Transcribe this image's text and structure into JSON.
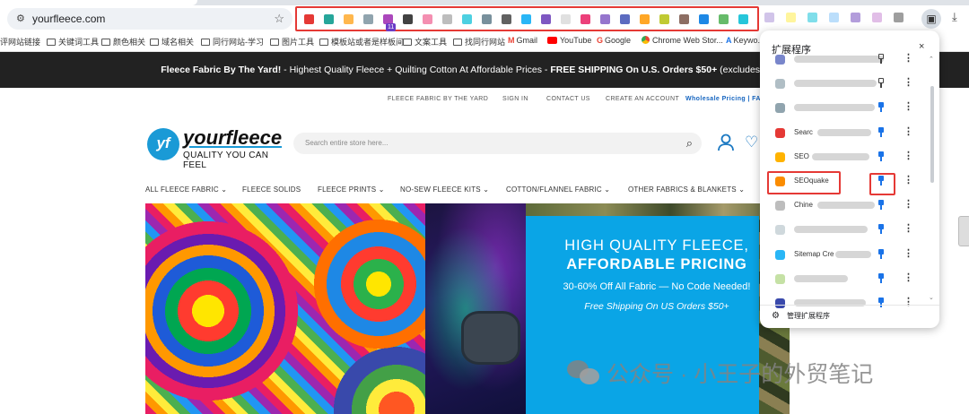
{
  "browser": {
    "url": "yourfleece.com",
    "bookmarks": [
      "评网站链接",
      "关键词工具",
      "颜色相关",
      "域名相关",
      "同行网站-学习",
      "图片工具",
      "模板站或者是样板间",
      "文案工具",
      "找同行网站",
      "Gmail",
      "YouTube",
      "Google",
      "Chrome Web Stor...",
      "Keywo..."
    ],
    "extension_badge": "11",
    "toolbar_extension_colors": [
      "#e53935",
      "#26a69a",
      "#ffb74d",
      "#90a4ae",
      "#ab47bc",
      "#424242",
      "#f48fb1",
      "#bdbdbd",
      "#4dd0e1",
      "#78909c",
      "#616161",
      "#29b6f6",
      "#7e57c2",
      "#e0e0e0",
      "#ec407a",
      "#9575cd",
      "#5c6bc0",
      "#ffa726",
      "#c0ca33",
      "#8d6e63",
      "#1e88e5",
      "#66bb6a",
      "#26c6da"
    ],
    "extra_extension_colors": [
      "#d1c4e9",
      "#fff59d",
      "#80deea",
      "#bbdefb",
      "#b39ddb",
      "#e1bee7",
      "#9e9e9e"
    ]
  },
  "promo": {
    "bold_a": "Fleece Fabric By The Yard!",
    "mid": " - Highest Quality Fleece + Quilting Cotton At Affordable Prices - ",
    "bold_b": "FREE SHIPPING On U.S. Orders $50+",
    "tail": " (excludes HI and AK)"
  },
  "util_links": {
    "fleece": "FLEECE FABRIC BY THE YARD",
    "signin": "SIGN IN",
    "contact": "CONTACT US",
    "create": "CREATE AN ACCOUNT",
    "wholesale": "Wholesale Pricing | FAQ"
  },
  "logo": {
    "mark": "yf",
    "word": "yourfleece",
    "tagline": "QUALITY YOU CAN FEEL"
  },
  "search": {
    "placeholder": "Search entire store here..."
  },
  "nav": [
    "ALL FLEECE FABRIC ⌄",
    "FLEECE SOLIDS",
    "FLEECE PRINTS ⌄",
    "NO-SEW FLEECE KITS ⌄",
    "COTTON/FLANNEL FABRIC ⌄",
    "OTHER FABRICS & BLANKETS ⌄"
  ],
  "hero": {
    "line1": "HIGH QUALITY FLEECE,",
    "line2": "AFFORDABLE PRICING",
    "line3": "30-60% Off All Fabric — No Code Needed!",
    "line4": "Free Shipping On US Orders $50+"
  },
  "popup": {
    "title": "扩展程序",
    "close": "×",
    "manage": "管理扩展程序",
    "items": [
      {
        "name": "",
        "color": "#7986cb",
        "pinned": false,
        "blur": [
          38,
          100
        ]
      },
      {
        "name": "",
        "color": "#b0bec5",
        "pinned": false,
        "blur": [
          38,
          92
        ]
      },
      {
        "name": "",
        "color": "#90a4ae",
        "pinned": true,
        "blur": [
          38,
          90
        ]
      },
      {
        "name": "Searc",
        "color": "#e53935",
        "pinned": true,
        "blur": [
          64,
          60
        ]
      },
      {
        "name": "SEO",
        "color": "#ffb300",
        "pinned": true,
        "blur": [
          58,
          64
        ]
      },
      {
        "name": "SEOquake",
        "color": "#fb8c00",
        "pinned": true,
        "blur": []
      },
      {
        "name": "Chine",
        "color": "#bdbdbd",
        "pinned": true,
        "blur": [
          64,
          64
        ]
      },
      {
        "name": "",
        "color": "#cfd8dc",
        "pinned": true,
        "blur": [
          38,
          82
        ]
      },
      {
        "name": "Sitemap Cre",
        "color": "#29b6f6",
        "pinned": true,
        "blur": [
          84,
          40
        ]
      },
      {
        "name": "",
        "color": "#c5e1a5",
        "pinned": true,
        "blur": [
          38,
          60
        ]
      },
      {
        "name": "",
        "color": "#3949ab",
        "pinned": true,
        "blur": [
          38,
          80
        ]
      }
    ]
  },
  "watermark": {
    "text": "公众号 · 小王子的外贸笔记"
  }
}
